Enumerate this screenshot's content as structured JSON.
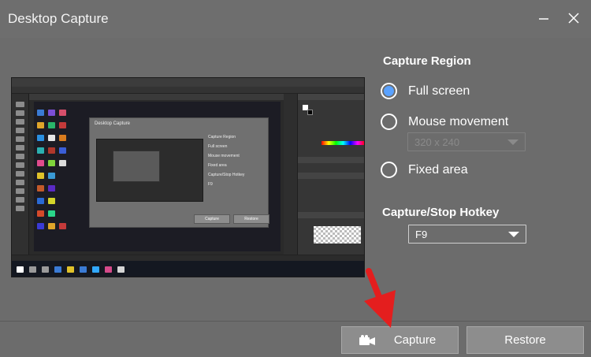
{
  "window": {
    "title": "Desktop Capture",
    "minimize_icon": "minimize-icon",
    "close_icon": "close-icon"
  },
  "capture_region": {
    "label": "Capture Region",
    "options": [
      {
        "label": "Full screen",
        "checked": true
      },
      {
        "label": "Mouse movement",
        "checked": false
      },
      {
        "label": "Fixed area",
        "checked": false
      }
    ],
    "mouse_size_select": {
      "value": "320 x 240",
      "enabled": false
    }
  },
  "hotkey": {
    "label": "Capture/Stop Hotkey",
    "value": "F9"
  },
  "buttons": {
    "capture": "Capture",
    "restore": "Restore"
  },
  "colors": {
    "background": "#6c6c6c",
    "radio_selected": "#5aa2ff",
    "button": "#8d8d8d",
    "annotation_arrow": "#e41e1e"
  },
  "preview": {
    "mini_dialog": {
      "title": "Desktop Capture",
      "capture_region_label": "Capture Region",
      "options": [
        "Full screen",
        "Mouse movement",
        "Fixed area"
      ],
      "hotkey_label": "Capture/Stop Hotkey",
      "hotkey_value": "F9",
      "capture": "Capture",
      "restore": "Restore"
    }
  }
}
